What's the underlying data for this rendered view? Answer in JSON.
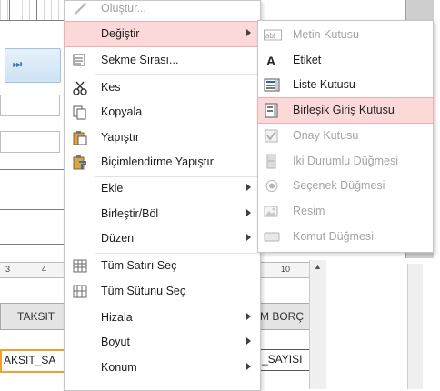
{
  "context_menu": {
    "items": [
      {
        "label": "Oluştur...",
        "icon": "create-icon",
        "disabled": true
      },
      {
        "label": "Değiştir",
        "icon": "none",
        "submenu": true,
        "highlighted": true
      },
      {
        "label": "Sekme Sırası...",
        "icon": "tab-order-icon"
      },
      {
        "label": "Kes",
        "icon": "scissors-icon"
      },
      {
        "label": "Kopyala",
        "icon": "copy-icon"
      },
      {
        "label": "Yapıştır",
        "icon": "paste-icon"
      },
      {
        "label": "Biçimlendirme Yapıştır",
        "icon": "paste-formatting-icon"
      },
      {
        "label": "Ekle",
        "icon": "none",
        "submenu": true
      },
      {
        "label": "Birleştir/Böl",
        "icon": "none",
        "submenu": true
      },
      {
        "label": "Düzen",
        "icon": "none",
        "submenu": true
      },
      {
        "label": "Tüm Satırı Seç",
        "icon": "select-row-icon"
      },
      {
        "label": "Tüm Sütunu Seç",
        "icon": "select-column-icon"
      },
      {
        "label": "Hizala",
        "icon": "none",
        "submenu": true
      },
      {
        "label": "Boyut",
        "icon": "none",
        "submenu": true
      },
      {
        "label": "Konum",
        "icon": "none",
        "submenu": true
      }
    ]
  },
  "change_submenu": {
    "items": [
      {
        "label": "Metin Kutusu",
        "icon": "textbox-icon",
        "disabled": true
      },
      {
        "label": "Etiket",
        "icon": "label-icon"
      },
      {
        "label": "Liste Kutusu",
        "icon": "listbox-icon"
      },
      {
        "label": "Birleşik Giriş Kutusu",
        "icon": "combobox-icon",
        "highlighted": true
      },
      {
        "label": "Onay Kutusu",
        "icon": "checkbox-icon",
        "disabled": true
      },
      {
        "label": "İki Durumlu Düğmesi",
        "icon": "toggle-button-icon",
        "disabled": true
      },
      {
        "label": "Seçenek Düğmesi",
        "icon": "option-button-icon",
        "disabled": true
      },
      {
        "label": "Resim",
        "icon": "image-icon",
        "disabled": true
      },
      {
        "label": "Komut Düğmesi",
        "icon": "command-button-icon",
        "disabled": true
      }
    ]
  },
  "background": {
    "nav_glyph": "⏭",
    "ruler_left": [
      "3",
      "4"
    ],
    "ruler_right": [
      "10"
    ],
    "header_left": "TAKSIT",
    "header_right": "M BORÇ",
    "field_left": "AKSIT_SA",
    "field_right": "_SAYISI"
  },
  "colors": {
    "highlight": "#fcd9d9",
    "highlight_border": "#f0aeb0",
    "disabled_text": "#a0a0a0",
    "selection_orange": "#f0a030"
  }
}
